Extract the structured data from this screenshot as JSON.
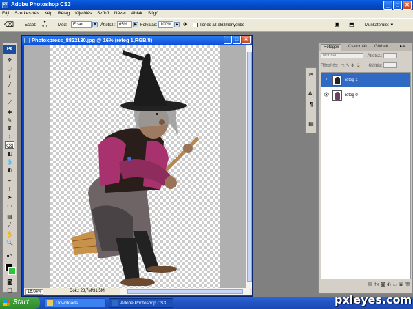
{
  "window": {
    "title": "Adobe Photoshop CS3",
    "controls": {
      "minimize": "_",
      "maximize": "□",
      "close": "✕"
    }
  },
  "menu": [
    "Fájl",
    "Szerkesztés",
    "Kép",
    "Réteg",
    "Kijelölés",
    "Szűrő",
    "Nézet",
    "Ablak",
    "Súgó"
  ],
  "options": {
    "brush_label": "Ecset:",
    "brush_size": "911",
    "mode_label": "Mód:",
    "mode_value": "Ecset",
    "opacity_label": "Áttetsz.:",
    "opacity_value": "65%",
    "flow_label": "Folyatás:",
    "flow_value": "100%",
    "erase_history_label": "Törlés az előzményekbe",
    "workspace_label": "Munkaterület ▼"
  },
  "tools": {
    "logo": "Ps",
    "icons": [
      "move-icon",
      "marquee-icon",
      "lasso-icon",
      "magic-wand-icon",
      "crop-icon",
      "slice-icon",
      "healing-icon",
      "brush-icon",
      "clone-stamp-icon",
      "history-brush-icon",
      "eraser-icon",
      "gradient-icon",
      "blur-icon",
      "dodge-icon",
      "pen-icon",
      "type-icon",
      "path-select-icon",
      "shape-icon",
      "notes-icon",
      "eyedropper-icon",
      "hand-icon",
      "zoom-icon"
    ],
    "foreground_color": "#000000",
    "background_color": "#2ec43a"
  },
  "document": {
    "title": "Photoxpress_8822130.jpg @ 16% (réteg 1,RGB/8)",
    "zoom": "16,04%",
    "doc_info": "Dok.: 28,7M/31,5M"
  },
  "layers_panel": {
    "tabs": [
      "Rétegek",
      "Csatornák",
      "Görbék"
    ],
    "blend_mode": "Normál",
    "opacity_label": "Áttetsz.:",
    "lock_label": "Rögzítés:",
    "fill_label": "Kitöltés:",
    "layers": [
      {
        "name": "réteg 1",
        "selected": true
      },
      {
        "name": "réteg 0",
        "selected": false
      }
    ]
  },
  "taskbar": {
    "start_label": "Start",
    "tasks": [
      {
        "label": "Downloads",
        "active": false
      },
      {
        "label": "Adobe Photoshop CS3",
        "active": true
      }
    ]
  },
  "watermark": "pxleyes.com"
}
